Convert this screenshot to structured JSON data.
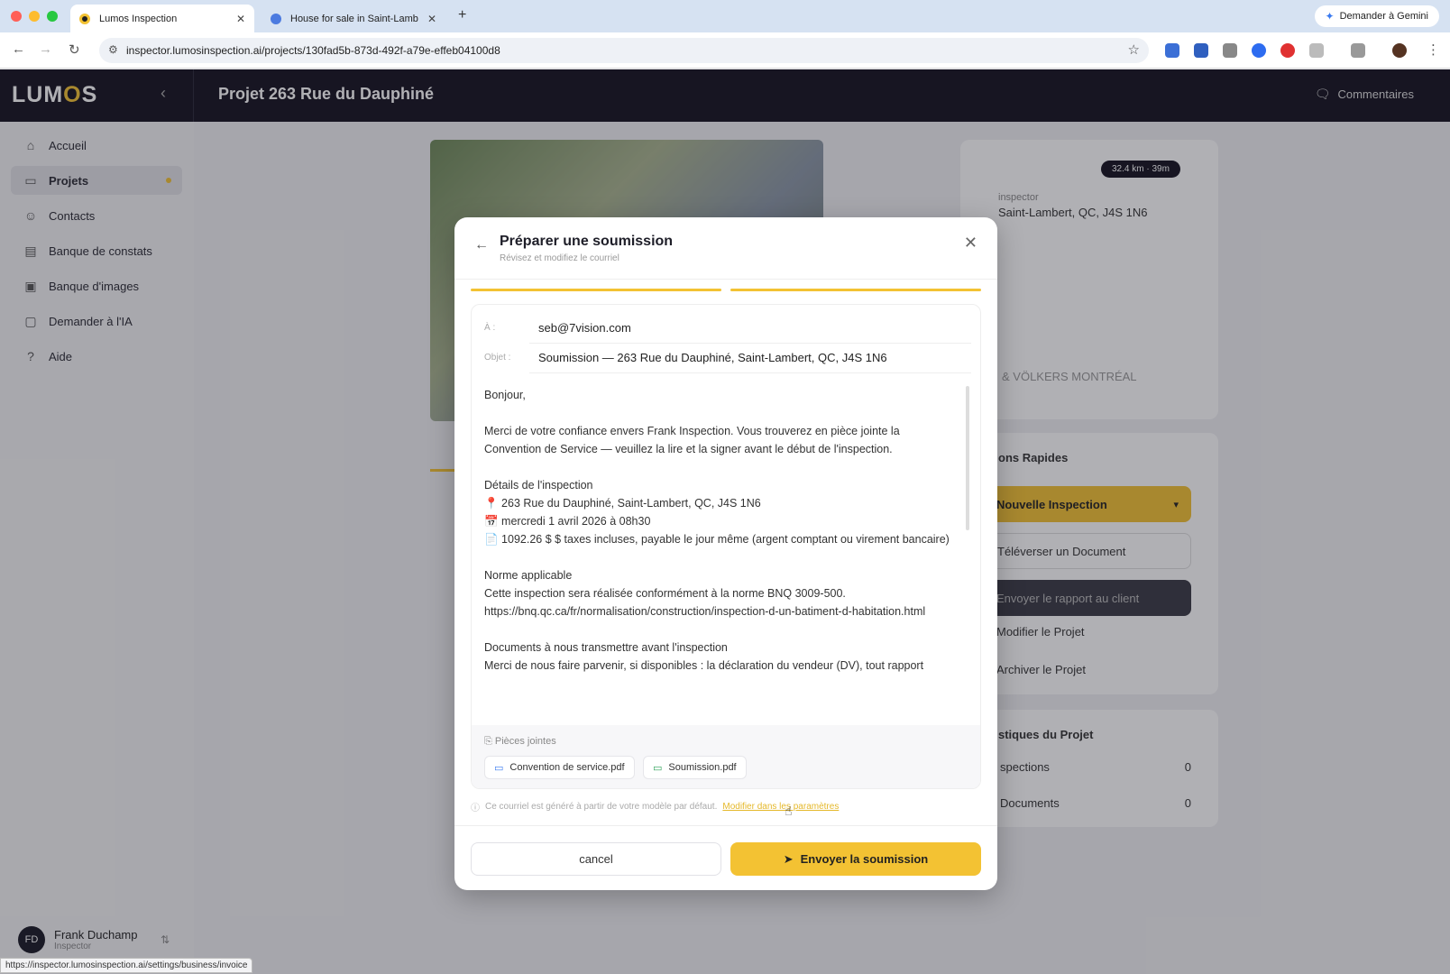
{
  "browser": {
    "tabs": [
      {
        "title": "Lumos Inspection",
        "active": true
      },
      {
        "title": "House for sale in Saint-Lamb",
        "active": false
      }
    ],
    "new_tab": "+",
    "gemini_label": "Demander à Gemini",
    "url": "inspector.lumosinspection.ai/projects/130fad5b-873d-492f-a79e-effeb04100d8",
    "status_url": "https://inspector.lumosinspection.ai/settings/business/invoice",
    "colors": {
      "red": "#ff5f57",
      "yellow": "#febc2e",
      "green": "#28c840"
    }
  },
  "app": {
    "logo_a": "LUM",
    "logo_b": "O",
    "logo_c": "S",
    "project_title": "Projet 263 Rue du Dauphiné",
    "comments_label": "Commentaires",
    "accent_color": "#f3c233",
    "sidebar": {
      "items": [
        {
          "label": "Accueil",
          "icon": "home-icon"
        },
        {
          "label": "Projets",
          "icon": "folder-icon"
        },
        {
          "label": "Contacts",
          "icon": "user-icon"
        },
        {
          "label": "Banque de constats",
          "icon": "document-icon"
        },
        {
          "label": "Banque d'images",
          "icon": "image-icon"
        },
        {
          "label": "Demander à l'IA",
          "icon": "chat-icon"
        },
        {
          "label": "Aide",
          "icon": "help-icon"
        }
      ],
      "user": {
        "initials": "FD",
        "name": "Frank Duchamp",
        "role": "Inspector"
      }
    }
  },
  "background": {
    "km_badge": "32.4 km · 39m",
    "inspector_label": "inspector",
    "address_partial": "Saint-Lambert, QC, J4S 1N6",
    "agency_partial": "& VÖLKERS MONTRÉAL",
    "quick_actions_title": "ons Rapides",
    "new_inspection": "Nouvelle Inspection",
    "upload_document": "Téléverser un Document",
    "send_report": "Envoyer le rapport au client",
    "edit_project": "Modifier le Projet",
    "archive_project": "Archiver le Projet",
    "stats_title": "stiques du Projet",
    "stats": [
      {
        "label": "spections",
        "value": "0"
      },
      {
        "label": "Documents",
        "value": "0"
      }
    ]
  },
  "modal": {
    "title": "Préparer une soumission",
    "subtitle": "Révisez et modifiez le courriel",
    "to_label": "À :",
    "to_value": "seb@7vision.com",
    "subject_label": "Objet :",
    "subject_value": "Soumission — 263 Rue du Dauphiné, Saint-Lambert, QC, J4S 1N6",
    "body": {
      "greeting": "Bonjour,",
      "intro": "Merci de votre confiance envers Frank Inspection. Vous trouverez en pièce jointe la Convention de Service — veuillez la lire et la signer avant le début de l'inspection.",
      "details_title": "Détails de l'inspection",
      "detail_address": "📍 263 Rue du Dauphiné, Saint-Lambert, QC, J4S 1N6",
      "detail_date": "📅 mercredi 1 avril 2026 à 08h30",
      "detail_price": "📄 1092.26 $ $ taxes incluses, payable le jour même (argent comptant ou virement bancaire)",
      "norm_title": "Norme applicable",
      "norm_text": "Cette inspection sera réalisée conformément à la norme BNQ 3009-500.",
      "norm_url": "https://bnq.qc.ca/fr/normalisation/construction/inspection-d-un-batiment-d-habitation.html",
      "docs_title": "Documents à nous transmettre avant l'inspection",
      "docs_text": "Merci de nous faire parvenir, si disponibles : la déclaration du vendeur (DV), tout rapport"
    },
    "attachments_label": "Pièces jointes",
    "attachments": [
      "Convention de service.pdf",
      "Soumission.pdf"
    ],
    "note": "Ce courriel est généré à partir de votre modèle par défaut.",
    "note_link": "Modifier dans les paramètres",
    "cancel_label": "cancel",
    "send_label": "Envoyer la soumission"
  }
}
